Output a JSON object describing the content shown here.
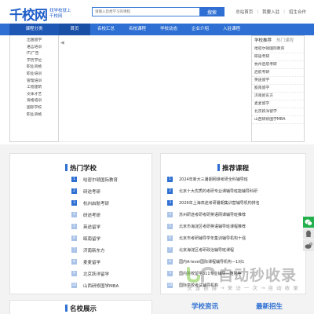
{
  "header": {
    "logo_text": "千校网",
    "slogan": "找学校就上千校网",
    "search_placeholder": "请输入您想学习的课程",
    "search_button": "搜索",
    "links": [
      "总站首页",
      "我要入驻",
      "招生合作"
    ]
  },
  "nav": {
    "category_label": "课程分类",
    "items": [
      "首页",
      "名校汇总",
      "名校课程",
      "学校动态",
      "企业介绍",
      "入驻课程"
    ]
  },
  "categories": [
    "出国留学",
    "语言培训",
    "IT/广告",
    "学历学位",
    "职业资格",
    "职业培训",
    "管理培训",
    "工程建筑",
    "文体才艺",
    "资格培训",
    "国际学校",
    "职业资格"
  ],
  "banner": {
    "prev_symbol": "◀"
  },
  "recommend": {
    "tabs": [
      "学校推荐",
      "热门课程"
    ],
    "items": [
      "哈密尔顿国际教育",
      "研途考研",
      "杭州启航考研",
      "启航考研",
      "英途留学",
      "瓯南留学",
      "济南新东方",
      "麦麦留学",
      "北京跃洋留学",
      "山西研修国学MBA"
    ]
  },
  "hot_schools": {
    "title": "热门学校",
    "items": [
      "哈密尔顿国际教育",
      "研途考研",
      "杭州启航考研",
      "研途考研",
      "英途留学",
      "瓯南留学",
      "济南新东方",
      "麦麦留学",
      "北京跃洋留学",
      "山西研修国学MBA"
    ]
  },
  "courses": {
    "title": "推荐课程",
    "items": [
      "2024年新大三暑期网课考研全科辅导班",
      "北京十大优质的考研专业课辅导班能辅导科研",
      "2026年上海高途考研暑期集训营辅导机构排名",
      "苏州研途考研考研英语网课辅导班推荐",
      "北京市海淀区考研英语辅导班课程推荐",
      "北京市考研辅导学年集训辅导机构十强",
      "北京海淀区考研政治辅导班课程",
      "国内A-level国际课程辅导机构—1对1",
      "国内院校留学311专业辅导—雅思等",
      "国际学校考试辅导机构"
    ]
  },
  "watermark": {
    "title": "自动秒收录",
    "subtitle": "快 速 链 接 → 来 访 一 次 → 自 动 收 录"
  },
  "bottom": {
    "show_title": "名校展示",
    "school_news": "学校资讯",
    "new_enroll": "最新招生"
  },
  "colors": {
    "primary": "#2e6fd3",
    "nav_active": "#1a4fa6",
    "wechat": "#21b04b"
  }
}
